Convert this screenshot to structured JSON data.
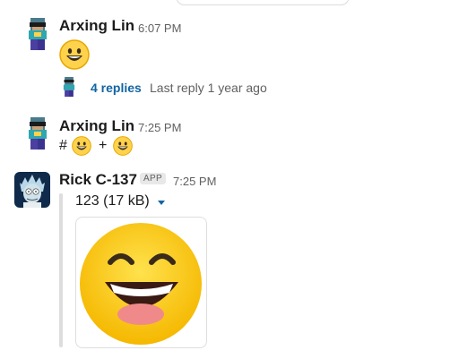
{
  "messages": [
    {
      "author": "Arxing Lin",
      "time": "6:07 PM",
      "body_emoji": "grinning-face",
      "thread": {
        "replies": "4 replies",
        "last_reply": "Last reply 1 year ago"
      }
    },
    {
      "author": "Arxing Lin",
      "time": "7:25 PM",
      "body_prefix": "#",
      "body_joiner": "+",
      "body_emojis": [
        "grinning-face",
        "grinning-face"
      ]
    },
    {
      "author": "Rick C-137",
      "badge": "APP",
      "time": "7:25 PM",
      "file": {
        "title": "123 (17 kB)",
        "image": "laughing-face"
      }
    }
  ],
  "colors": {
    "link": "#1264a3",
    "muted": "#616061",
    "text": "#1d1c1d"
  },
  "icons": {
    "avatar_1": "minecraft-avatar",
    "avatar_2": "rick-avatar",
    "caret": "chevron-down-icon"
  }
}
